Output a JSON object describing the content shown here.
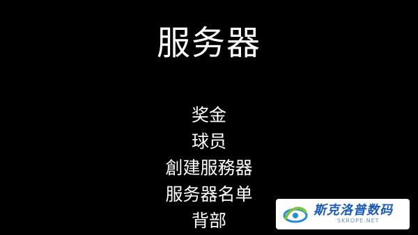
{
  "header": {
    "title": "服务器"
  },
  "menu": {
    "items": [
      {
        "label": "奖金"
      },
      {
        "label": "球员"
      },
      {
        "label": "創建服務器"
      },
      {
        "label": "服务器名单"
      },
      {
        "label": "背部"
      }
    ]
  },
  "watermark": {
    "brand": "斯克洛普数码",
    "url": "SKROPE.NET",
    "icon": "skrope-logo-icon",
    "colors": {
      "brand": "#1a5bb8",
      "swirl_green": "#7fc241",
      "swirl_blue": "#1e8fd6"
    }
  },
  "colors": {
    "background": "#000000",
    "text": "#ffffff"
  }
}
